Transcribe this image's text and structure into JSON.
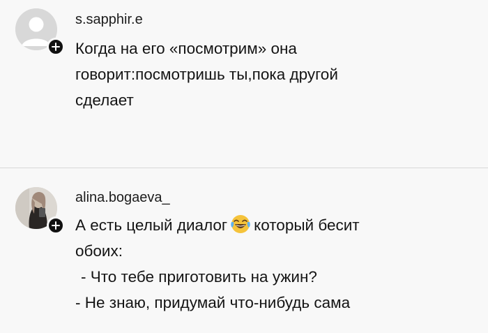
{
  "comments": [
    {
      "username": "s.sapphir.e",
      "avatar": "default-avatar-icon",
      "badge": "add-follow-icon",
      "lines": [
        "Когда на его «посмотрим» она",
        "говорит:посмотришь ты,пока другой",
        "сделает"
      ]
    },
    {
      "username": "alina.bogaeva_",
      "avatar": "user-photo",
      "badge": "add-follow-icon",
      "lines": [
        {
          "before": "А есть целый диалог",
          "emoji": "face-with-tears-of-joy-icon",
          "after": "который бесит"
        },
        "обоих:",
        " - Что тебе приготовить на ужин?",
        "- Не знаю, придумай что-нибудь сама"
      ]
    }
  ],
  "colors": {
    "background": "#f8f8f8",
    "text": "#141414",
    "badge": "#111111",
    "divider": "#d8d8d8"
  }
}
